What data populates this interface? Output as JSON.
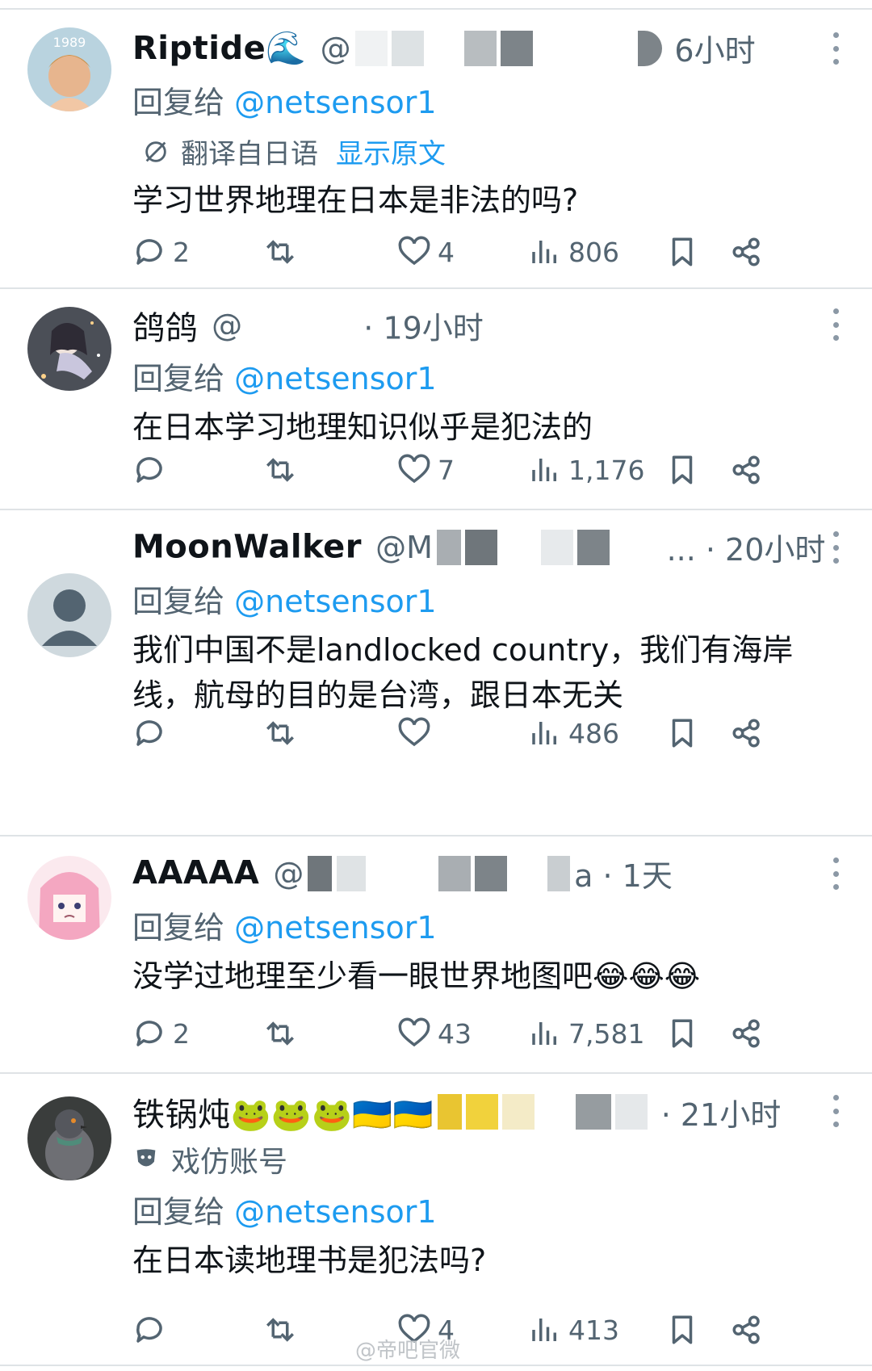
{
  "reply_prefix": "回复给",
  "tweets": [
    {
      "name": "Riptide🌊",
      "handle": "@",
      "time": "6小时",
      "reply_to": "@netsensor1",
      "translated_label": "翻译自日语",
      "show_original": "显示原文",
      "text": "学习世界地理在日本是非法的吗?",
      "replies": "2",
      "likes": "4",
      "views": "806"
    },
    {
      "name": "鸽鸽",
      "handle": "@",
      "time": "· 19小时",
      "reply_to": "@netsensor1",
      "text": "在日本学习地理知识似乎是犯法的",
      "replies": "",
      "likes": "7",
      "views": "1,176"
    },
    {
      "name": "MoonWalker",
      "handle": "@M",
      "time": "... · 20小时",
      "reply_to": "@netsensor1",
      "text": "我们中国不是landlocked country，我们有海岸线，航母的目的是台湾，跟日本无关",
      "replies": "",
      "likes": "",
      "views": "486"
    },
    {
      "name": "AAAAA",
      "handle": "@",
      "time": "a · 1天",
      "reply_to": "@netsensor1",
      "text": "没学过地理至少看一眼世界地图吧😂😂😂",
      "replies": "2",
      "likes": "43",
      "views": "7,581"
    },
    {
      "name": "铁锅炖🐸🐸🐸🇺🇦🇺🇦",
      "handle": "",
      "time": "· 21小时",
      "parody_label": "戏仿账号",
      "reply_to": "@netsensor1",
      "text": "在日本读地理书是犯法吗?",
      "replies": "",
      "likes": "4",
      "views": "413"
    }
  ],
  "watermark": "@帝吧官微",
  "colors": {
    "accent": "#1d9bf0",
    "muted": "#536471",
    "divider": "#dfe3e6"
  }
}
